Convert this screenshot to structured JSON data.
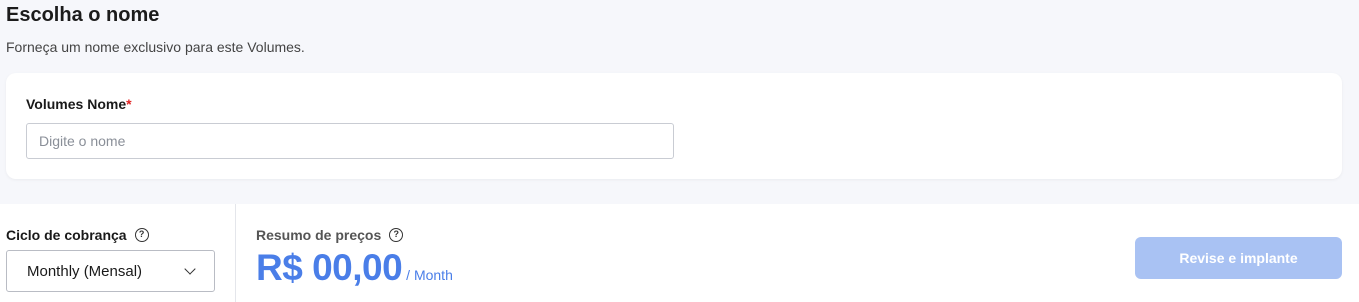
{
  "header": {
    "title": "Escolha o nome",
    "description": "Forneça um nome exclusivo para este Volumes."
  },
  "name_field": {
    "label": "Volumes Nome",
    "required_mark": "*",
    "placeholder": "Digite o nome",
    "value": ""
  },
  "billing": {
    "label": "Ciclo de cobrança",
    "help_icon": "question-circle-icon",
    "selected": "Monthly (Mensal)"
  },
  "pricing": {
    "label": "Resumo de preços",
    "help_icon": "question-circle-icon",
    "amount": "R$ 00,00",
    "period": "/ Month"
  },
  "actions": {
    "deploy_label": "Revise e implante",
    "deploy_enabled": false
  },
  "colors": {
    "accent": "#4a7ee8",
    "button_disabled": "#a9c2f3",
    "required": "#e02424"
  }
}
